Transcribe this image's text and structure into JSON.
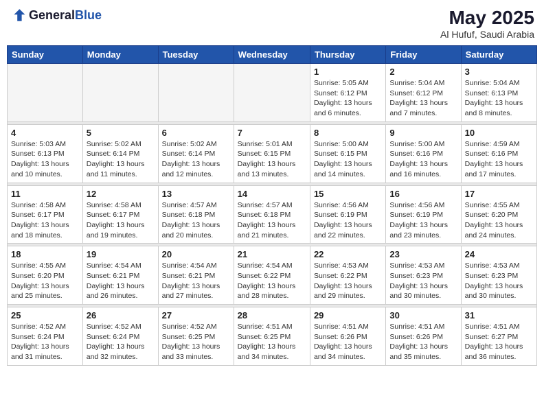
{
  "header": {
    "logo_general": "General",
    "logo_blue": "Blue",
    "month_year": "May 2025",
    "location": "Al Hufuf, Saudi Arabia"
  },
  "days_of_week": [
    "Sunday",
    "Monday",
    "Tuesday",
    "Wednesday",
    "Thursday",
    "Friday",
    "Saturday"
  ],
  "weeks": [
    [
      {
        "day": "",
        "empty": true
      },
      {
        "day": "",
        "empty": true
      },
      {
        "day": "",
        "empty": true
      },
      {
        "day": "",
        "empty": true
      },
      {
        "day": "1",
        "sunrise": "5:05 AM",
        "sunset": "6:12 PM",
        "daylight": "13 hours and 6 minutes."
      },
      {
        "day": "2",
        "sunrise": "5:04 AM",
        "sunset": "6:12 PM",
        "daylight": "13 hours and 7 minutes."
      },
      {
        "day": "3",
        "sunrise": "5:04 AM",
        "sunset": "6:13 PM",
        "daylight": "13 hours and 8 minutes."
      }
    ],
    [
      {
        "day": "4",
        "sunrise": "5:03 AM",
        "sunset": "6:13 PM",
        "daylight": "13 hours and 10 minutes."
      },
      {
        "day": "5",
        "sunrise": "5:02 AM",
        "sunset": "6:14 PM",
        "daylight": "13 hours and 11 minutes."
      },
      {
        "day": "6",
        "sunrise": "5:02 AM",
        "sunset": "6:14 PM",
        "daylight": "13 hours and 12 minutes."
      },
      {
        "day": "7",
        "sunrise": "5:01 AM",
        "sunset": "6:15 PM",
        "daylight": "13 hours and 13 minutes."
      },
      {
        "day": "8",
        "sunrise": "5:00 AM",
        "sunset": "6:15 PM",
        "daylight": "13 hours and 14 minutes."
      },
      {
        "day": "9",
        "sunrise": "5:00 AM",
        "sunset": "6:16 PM",
        "daylight": "13 hours and 16 minutes."
      },
      {
        "day": "10",
        "sunrise": "4:59 AM",
        "sunset": "6:16 PM",
        "daylight": "13 hours and 17 minutes."
      }
    ],
    [
      {
        "day": "11",
        "sunrise": "4:58 AM",
        "sunset": "6:17 PM",
        "daylight": "13 hours and 18 minutes."
      },
      {
        "day": "12",
        "sunrise": "4:58 AM",
        "sunset": "6:17 PM",
        "daylight": "13 hours and 19 minutes."
      },
      {
        "day": "13",
        "sunrise": "4:57 AM",
        "sunset": "6:18 PM",
        "daylight": "13 hours and 20 minutes."
      },
      {
        "day": "14",
        "sunrise": "4:57 AM",
        "sunset": "6:18 PM",
        "daylight": "13 hours and 21 minutes."
      },
      {
        "day": "15",
        "sunrise": "4:56 AM",
        "sunset": "6:19 PM",
        "daylight": "13 hours and 22 minutes."
      },
      {
        "day": "16",
        "sunrise": "4:56 AM",
        "sunset": "6:19 PM",
        "daylight": "13 hours and 23 minutes."
      },
      {
        "day": "17",
        "sunrise": "4:55 AM",
        "sunset": "6:20 PM",
        "daylight": "13 hours and 24 minutes."
      }
    ],
    [
      {
        "day": "18",
        "sunrise": "4:55 AM",
        "sunset": "6:20 PM",
        "daylight": "13 hours and 25 minutes."
      },
      {
        "day": "19",
        "sunrise": "4:54 AM",
        "sunset": "6:21 PM",
        "daylight": "13 hours and 26 minutes."
      },
      {
        "day": "20",
        "sunrise": "4:54 AM",
        "sunset": "6:21 PM",
        "daylight": "13 hours and 27 minutes."
      },
      {
        "day": "21",
        "sunrise": "4:54 AM",
        "sunset": "6:22 PM",
        "daylight": "13 hours and 28 minutes."
      },
      {
        "day": "22",
        "sunrise": "4:53 AM",
        "sunset": "6:22 PM",
        "daylight": "13 hours and 29 minutes."
      },
      {
        "day": "23",
        "sunrise": "4:53 AM",
        "sunset": "6:23 PM",
        "daylight": "13 hours and 30 minutes."
      },
      {
        "day": "24",
        "sunrise": "4:53 AM",
        "sunset": "6:23 PM",
        "daylight": "13 hours and 30 minutes."
      }
    ],
    [
      {
        "day": "25",
        "sunrise": "4:52 AM",
        "sunset": "6:24 PM",
        "daylight": "13 hours and 31 minutes."
      },
      {
        "day": "26",
        "sunrise": "4:52 AM",
        "sunset": "6:24 PM",
        "daylight": "13 hours and 32 minutes."
      },
      {
        "day": "27",
        "sunrise": "4:52 AM",
        "sunset": "6:25 PM",
        "daylight": "13 hours and 33 minutes."
      },
      {
        "day": "28",
        "sunrise": "4:51 AM",
        "sunset": "6:25 PM",
        "daylight": "13 hours and 34 minutes."
      },
      {
        "day": "29",
        "sunrise": "4:51 AM",
        "sunset": "6:26 PM",
        "daylight": "13 hours and 34 minutes."
      },
      {
        "day": "30",
        "sunrise": "4:51 AM",
        "sunset": "6:26 PM",
        "daylight": "13 hours and 35 minutes."
      },
      {
        "day": "31",
        "sunrise": "4:51 AM",
        "sunset": "6:27 PM",
        "daylight": "13 hours and 36 minutes."
      }
    ]
  ]
}
